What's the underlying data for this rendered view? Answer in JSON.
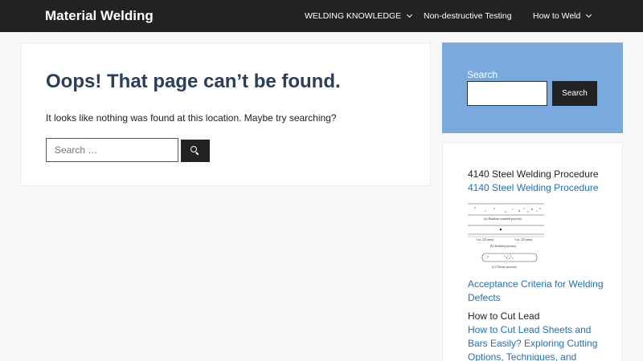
{
  "header": {
    "site_title": "Material Welding",
    "nav": [
      {
        "label": "WELDING KNOWLEDGE",
        "has_dropdown": true
      },
      {
        "label": "Non-destructive Testing",
        "has_dropdown": false
      },
      {
        "label": "How to Weld",
        "has_dropdown": true
      }
    ]
  },
  "main": {
    "title": "Oops! That page can’t be found.",
    "message": "It looks like nothing was found at this location. Maybe try searching?",
    "search": {
      "placeholder": "Search …",
      "value": "",
      "button_icon": "search-icon"
    }
  },
  "sidebar": {
    "search_widget": {
      "label": "Search",
      "value": "",
      "button_label": "Search"
    },
    "posts": [
      {
        "title": "4140 Steel Welding Procedure",
        "link": "4140 Steel Welding Procedure"
      },
      {
        "thumbnail_captions": [
          "(a) Random rounded porosity",
          "(b) Isolated porosity",
          "(c) Cluster porosity"
        ],
        "thumbnail_dims": [
          "1 in. (25 mm)",
          "1 in. (25 mm)"
        ],
        "link": "Acceptance Criteria for Welding Defects"
      },
      {
        "title": "How to Cut Lead",
        "link": "How to Cut Lead Sheets and Bars Easily? Exploring Cutting Options, Techniques, and"
      }
    ]
  },
  "colors": {
    "header_bg": "#222222",
    "page_bg": "#f7f8f9",
    "title_color": "#2b3e5a",
    "link_color": "#1e72bd",
    "sidebar_search_bg": "#7aaadd"
  }
}
